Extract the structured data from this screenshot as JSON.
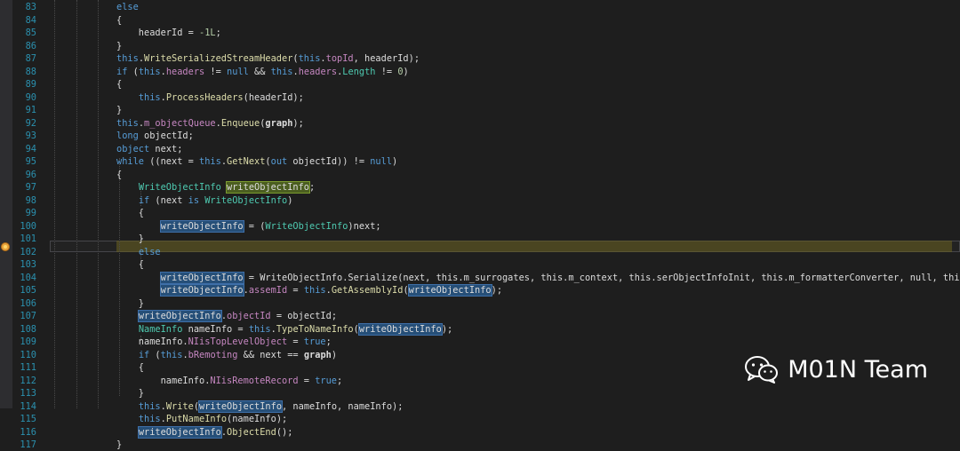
{
  "editor": {
    "lines": [
      {
        "num": "83",
        "segments": [
          {
            "t": "else",
            "c": "kw"
          }
        ]
      },
      {
        "num": "84",
        "segments": [
          {
            "t": "{"
          }
        ]
      },
      {
        "num": "85",
        "segments": [
          {
            "t": "    headerId = "
          },
          {
            "t": "-1L",
            "c": "num"
          },
          {
            "t": ";"
          }
        ]
      },
      {
        "num": "86",
        "segments": [
          {
            "t": "}"
          }
        ]
      },
      {
        "num": "87",
        "segments": [
          {
            "t": "this",
            "c": "kw"
          },
          {
            "t": "."
          },
          {
            "t": "WriteSerializedStreamHeader",
            "c": "mth"
          },
          {
            "t": "("
          },
          {
            "t": "this",
            "c": "kw"
          },
          {
            "t": "."
          },
          {
            "t": "topId",
            "c": "fld"
          },
          {
            "t": ", headerId);"
          }
        ]
      },
      {
        "num": "88",
        "segments": [
          {
            "t": "if",
            "c": "kw"
          },
          {
            "t": " ("
          },
          {
            "t": "this",
            "c": "kw"
          },
          {
            "t": "."
          },
          {
            "t": "headers",
            "c": "fld"
          },
          {
            "t": " != "
          },
          {
            "t": "null",
            "c": "kw"
          },
          {
            "t": " && "
          },
          {
            "t": "this",
            "c": "kw"
          },
          {
            "t": "."
          },
          {
            "t": "headers",
            "c": "fld"
          },
          {
            "t": "."
          },
          {
            "t": "Length",
            "c": "cls"
          },
          {
            "t": " != "
          },
          {
            "t": "0",
            "c": "num"
          },
          {
            "t": ")"
          }
        ]
      },
      {
        "num": "89",
        "segments": [
          {
            "t": "{"
          }
        ]
      },
      {
        "num": "90",
        "segments": [
          {
            "t": "    "
          },
          {
            "t": "this",
            "c": "kw"
          },
          {
            "t": "."
          },
          {
            "t": "ProcessHeaders",
            "c": "mth"
          },
          {
            "t": "(headerId);"
          }
        ]
      },
      {
        "num": "91",
        "segments": [
          {
            "t": "}"
          }
        ]
      },
      {
        "num": "92",
        "segments": [
          {
            "t": "this",
            "c": "kw"
          },
          {
            "t": "."
          },
          {
            "t": "m_objectQueue",
            "c": "fld"
          },
          {
            "t": "."
          },
          {
            "t": "Enqueue",
            "c": "mth"
          },
          {
            "t": "("
          },
          {
            "t": "graph",
            "c": "bold"
          },
          {
            "t": ");"
          }
        ]
      },
      {
        "num": "93",
        "segments": [
          {
            "t": "long",
            "c": "kw"
          },
          {
            "t": " objectId;"
          }
        ]
      },
      {
        "num": "94",
        "segments": [
          {
            "t": "object",
            "c": "kw"
          },
          {
            "t": " next;"
          }
        ]
      },
      {
        "num": "95",
        "segments": [
          {
            "t": "while",
            "c": "kw"
          },
          {
            "t": " ((next = "
          },
          {
            "t": "this",
            "c": "kw"
          },
          {
            "t": "."
          },
          {
            "t": "GetNext",
            "c": "mth"
          },
          {
            "t": "("
          },
          {
            "t": "out",
            "c": "kw"
          },
          {
            "t": " objectId)) != "
          },
          {
            "t": "null",
            "c": "kw"
          },
          {
            "t": ")"
          }
        ]
      },
      {
        "num": "96",
        "segments": [
          {
            "t": "{"
          }
        ]
      },
      {
        "num": "97",
        "segments": [
          {
            "t": "    "
          },
          {
            "t": "WriteObjectInfo",
            "c": "cls"
          },
          {
            "t": " "
          },
          {
            "t": "writeObjectInfo",
            "c": "def"
          },
          {
            "t": ";"
          }
        ]
      },
      {
        "num": "98",
        "segments": [
          {
            "t": "    "
          },
          {
            "t": "if",
            "c": "kw"
          },
          {
            "t": " (next "
          },
          {
            "t": "is",
            "c": "kw"
          },
          {
            "t": " "
          },
          {
            "t": "WriteObjectInfo",
            "c": "cls"
          },
          {
            "t": ")"
          }
        ]
      },
      {
        "num": "99",
        "segments": [
          {
            "t": "    {"
          }
        ]
      },
      {
        "num": "100",
        "segments": [
          {
            "t": "        "
          },
          {
            "t": "writeObjectInfo",
            "c": "ref"
          },
          {
            "t": " = ("
          },
          {
            "t": "WriteObjectInfo",
            "c": "cls"
          },
          {
            "t": ")next;"
          }
        ]
      },
      {
        "num": "101",
        "segments": [
          {
            "t": "    }"
          }
        ]
      },
      {
        "num": "102",
        "segments": [
          {
            "t": "    "
          },
          {
            "t": "else",
            "c": "kw"
          }
        ]
      },
      {
        "num": "103",
        "segments": [
          {
            "t": "    {"
          }
        ]
      },
      {
        "num": "104",
        "segments": [
          {
            "t": "        "
          },
          {
            "t": "writeObjectInfo",
            "c": "ref"
          },
          {
            "t": " = WriteObjectInfo.Serialize(next, this.m_surrogates, this.m_context, this.serObjectInfoInit, this.m_formatterConverter, null, this);"
          }
        ]
      },
      {
        "num": "105",
        "segments": [
          {
            "t": "        "
          },
          {
            "t": "writeObjectInfo",
            "c": "ref"
          },
          {
            "t": "."
          },
          {
            "t": "assemId",
            "c": "fld"
          },
          {
            "t": " = "
          },
          {
            "t": "this",
            "c": "kw"
          },
          {
            "t": "."
          },
          {
            "t": "GetAssemblyId",
            "c": "mth"
          },
          {
            "t": "("
          },
          {
            "t": "writeObjectInfo",
            "c": "ref"
          },
          {
            "t": ");"
          }
        ]
      },
      {
        "num": "106",
        "segments": [
          {
            "t": "    }"
          }
        ]
      },
      {
        "num": "107",
        "segments": [
          {
            "t": "    "
          },
          {
            "t": "writeObjectInfo",
            "c": "ref"
          },
          {
            "t": "."
          },
          {
            "t": "objectId",
            "c": "fld"
          },
          {
            "t": " = objectId;"
          }
        ]
      },
      {
        "num": "108",
        "segments": [
          {
            "t": "    "
          },
          {
            "t": "NameInfo",
            "c": "cls"
          },
          {
            "t": " nameInfo = "
          },
          {
            "t": "this",
            "c": "kw"
          },
          {
            "t": "."
          },
          {
            "t": "TypeToNameInfo",
            "c": "mth"
          },
          {
            "t": "("
          },
          {
            "t": "writeObjectInfo",
            "c": "ref"
          },
          {
            "t": ");"
          }
        ]
      },
      {
        "num": "109",
        "segments": [
          {
            "t": "    nameInfo."
          },
          {
            "t": "NIisTopLevelObject",
            "c": "fld"
          },
          {
            "t": " = "
          },
          {
            "t": "true",
            "c": "kw"
          },
          {
            "t": ";"
          }
        ]
      },
      {
        "num": "110",
        "segments": [
          {
            "t": "    "
          },
          {
            "t": "if",
            "c": "kw"
          },
          {
            "t": " ("
          },
          {
            "t": "this",
            "c": "kw"
          },
          {
            "t": "."
          },
          {
            "t": "bRemoting",
            "c": "fld"
          },
          {
            "t": " && next == "
          },
          {
            "t": "graph",
            "c": "bold"
          },
          {
            "t": ")"
          }
        ]
      },
      {
        "num": "111",
        "segments": [
          {
            "t": "    {"
          }
        ]
      },
      {
        "num": "112",
        "segments": [
          {
            "t": "        nameInfo."
          },
          {
            "t": "NIisRemoteRecord",
            "c": "fld"
          },
          {
            "t": " = "
          },
          {
            "t": "true",
            "c": "kw"
          },
          {
            "t": ";"
          }
        ]
      },
      {
        "num": "113",
        "segments": [
          {
            "t": "    }"
          }
        ]
      },
      {
        "num": "114",
        "segments": [
          {
            "t": "    "
          },
          {
            "t": "this",
            "c": "kw"
          },
          {
            "t": "."
          },
          {
            "t": "Write",
            "c": "mth"
          },
          {
            "t": "("
          },
          {
            "t": "writeObjectInfo",
            "c": "ref"
          },
          {
            "t": ", nameInfo, nameInfo);"
          }
        ]
      },
      {
        "num": "115",
        "segments": [
          {
            "t": "    "
          },
          {
            "t": "this",
            "c": "kw"
          },
          {
            "t": "."
          },
          {
            "t": "PutNameInfo",
            "c": "mth"
          },
          {
            "t": "(nameInfo);"
          }
        ]
      },
      {
        "num": "116",
        "segments": [
          {
            "t": "    "
          },
          {
            "t": "writeObjectInfo",
            "c": "ref"
          },
          {
            "t": "."
          },
          {
            "t": "ObjectEnd",
            "c": "mth"
          },
          {
            "t": "();"
          }
        ]
      },
      {
        "num": "117",
        "segments": [
          {
            "t": "}"
          }
        ]
      }
    ],
    "current_line": "104",
    "breakpoint_line": "104"
  },
  "watermark": {
    "icon": "wechat-icon",
    "text": "M01N Team"
  },
  "colors": {
    "background": "#1e1e1e",
    "line_number": "#2b91af",
    "keyword": "#569cd6",
    "type": "#4ec9b0",
    "member": "#c586c0",
    "method": "#dcdcaa",
    "reference_highlight": "#264f78",
    "definition_highlight": "#4b5e20",
    "breakpoint": "#e7a23c"
  }
}
